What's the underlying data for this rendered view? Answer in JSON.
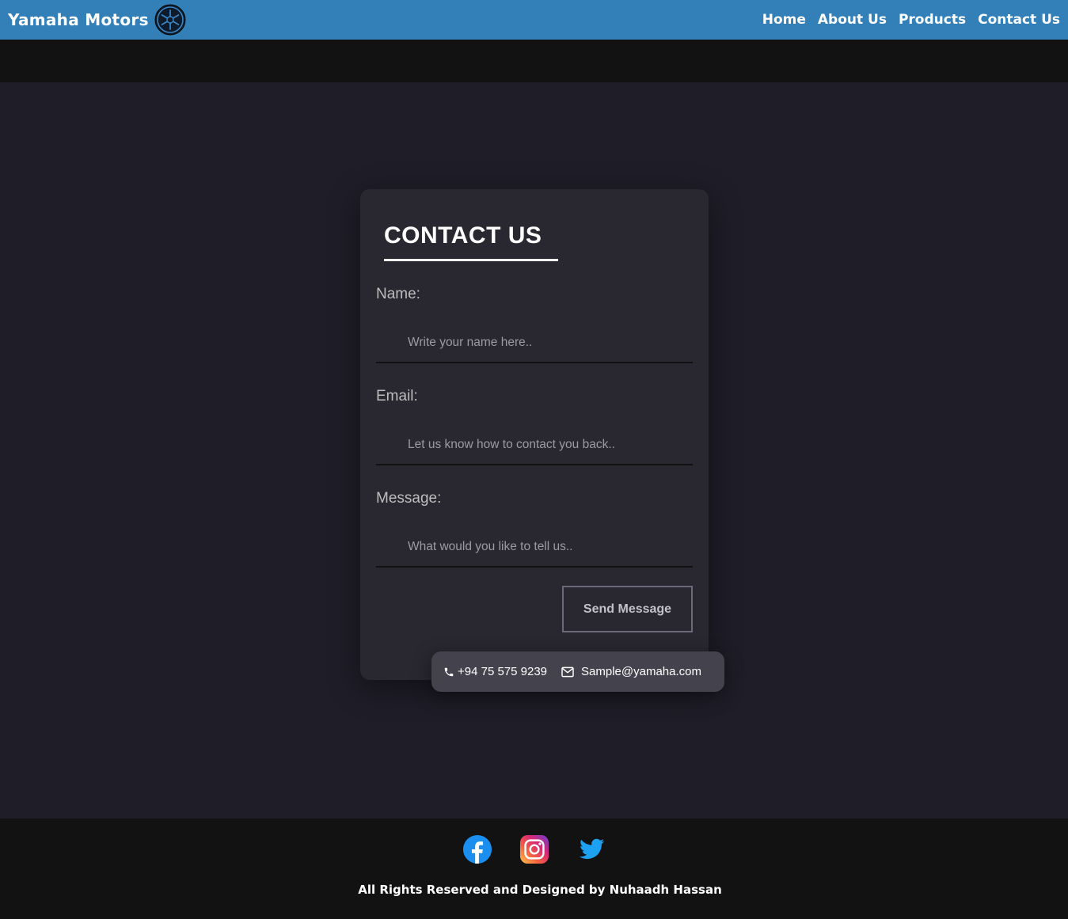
{
  "navbar": {
    "brand": "Yamaha Motors",
    "logo_icon": "yamaha-tuning-fork-logo",
    "links": [
      {
        "label": "Home"
      },
      {
        "label": "About Us"
      },
      {
        "label": "Products"
      },
      {
        "label": "Contact Us"
      }
    ],
    "bg_color": "#3380b8"
  },
  "contact_form": {
    "title": "CONTACT US",
    "name_label": "Name:",
    "name_placeholder": "Write your name here..",
    "email_label": "Email:",
    "email_placeholder": "Let us know how to contact you back..",
    "message_label": "Message:",
    "message_placeholder": "What would you like to tell us..",
    "send_label": "Send Message"
  },
  "contact_info": {
    "phone_icon": "phone-icon",
    "phone": "+94 75 575 9239",
    "email_icon": "envelope-icon",
    "email": "Sample@yamaha.com"
  },
  "footer": {
    "socials": [
      "facebook-icon",
      "instagram-icon",
      "twitter-icon"
    ],
    "copyright": "All Rights Reserved and Designed by Nuhaadh Hassan",
    "bg_color": "#121212"
  },
  "colors": {
    "page_bg": "#1f1d28",
    "card_bg": "#29272f",
    "chip_bg": "#44424c"
  }
}
